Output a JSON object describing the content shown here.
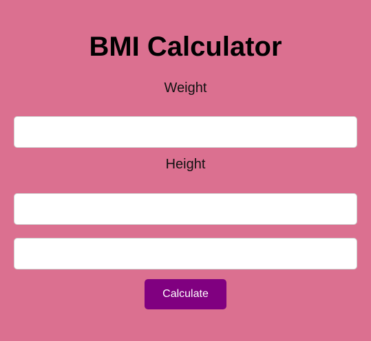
{
  "title": "BMI Calculator",
  "form": {
    "weight_label": "Weight",
    "weight_value": "",
    "height_label": "Height",
    "height_value": "",
    "result_value": "",
    "calculate_label": "Calculate"
  },
  "colors": {
    "background": "#db7090",
    "button": "#800080",
    "field_background": "#ffffff",
    "field_border": "#cfcfcf"
  }
}
